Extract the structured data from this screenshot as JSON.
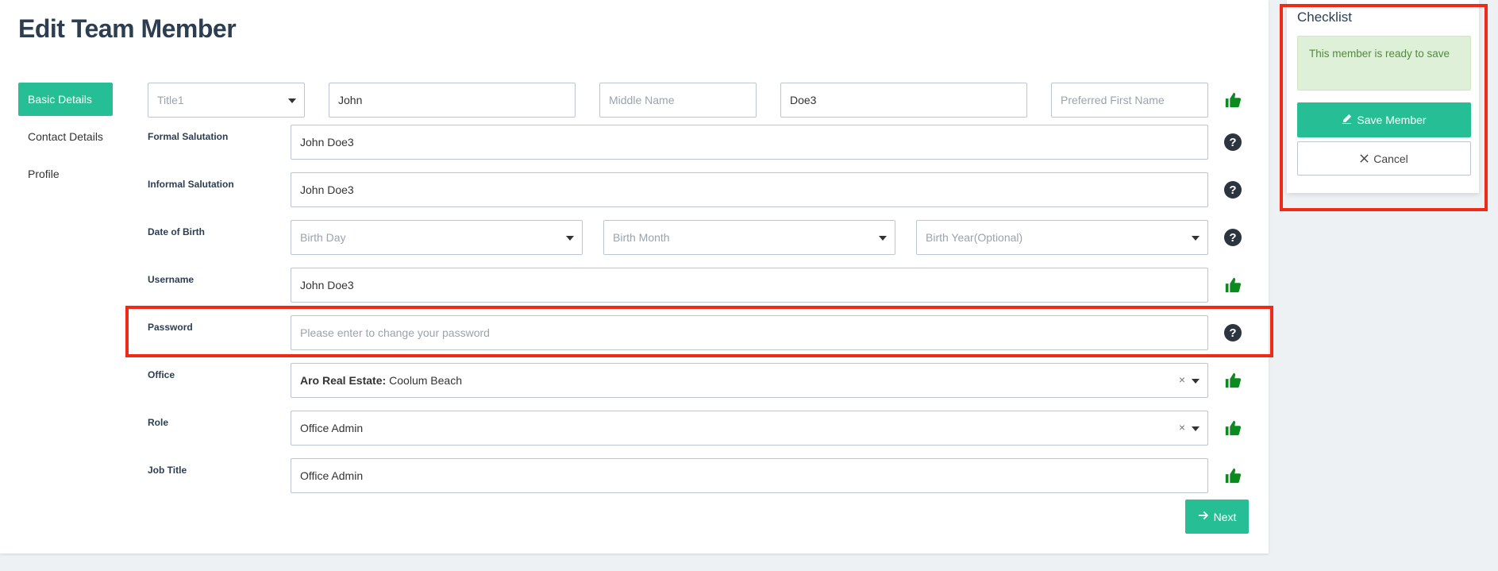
{
  "page": {
    "title": "Edit Team Member"
  },
  "nav": {
    "items": [
      {
        "label": "Basic Details",
        "active": true
      },
      {
        "label": "Contact Details",
        "active": false
      },
      {
        "label": "Profile",
        "active": false
      }
    ]
  },
  "name_row": {
    "title_placeholder": "Title1",
    "first_name": "John",
    "middle_name_placeholder": "Middle Name",
    "last_name": "Doe3",
    "preferred_first_name_placeholder": "Preferred First Name"
  },
  "formal_salutation": {
    "label": "Formal Salutation",
    "value": "John Doe3"
  },
  "informal_salutation": {
    "label": "Informal Salutation",
    "value": "John Doe3"
  },
  "date_of_birth": {
    "label": "Date of Birth",
    "day_placeholder": "Birth Day",
    "month_placeholder": "Birth Month",
    "year_placeholder": "Birth Year(Optional)"
  },
  "username": {
    "label": "Username",
    "value": "John Doe3"
  },
  "password": {
    "label": "Password",
    "placeholder": "Please enter to change your password"
  },
  "office": {
    "label": "Office",
    "value_bold": "Aro Real Estate:",
    "value_rest": "Coolum Beach",
    "clear": "×"
  },
  "role": {
    "label": "Role",
    "value": "Office Admin",
    "clear": "×"
  },
  "job_title": {
    "label": "Job Title",
    "value": "Office Admin"
  },
  "next_button": {
    "label": "Next"
  },
  "checklist": {
    "title": "Checklist",
    "status_message": "This member is ready to save",
    "save_label": "Save Member",
    "cancel_label": "Cancel"
  },
  "colors": {
    "accent": "#26bf95",
    "highlight": "#f02a16",
    "success_bg": "#dff0d8",
    "success_text": "#4f8b3c",
    "thumb_green": "#0b8a1f"
  }
}
